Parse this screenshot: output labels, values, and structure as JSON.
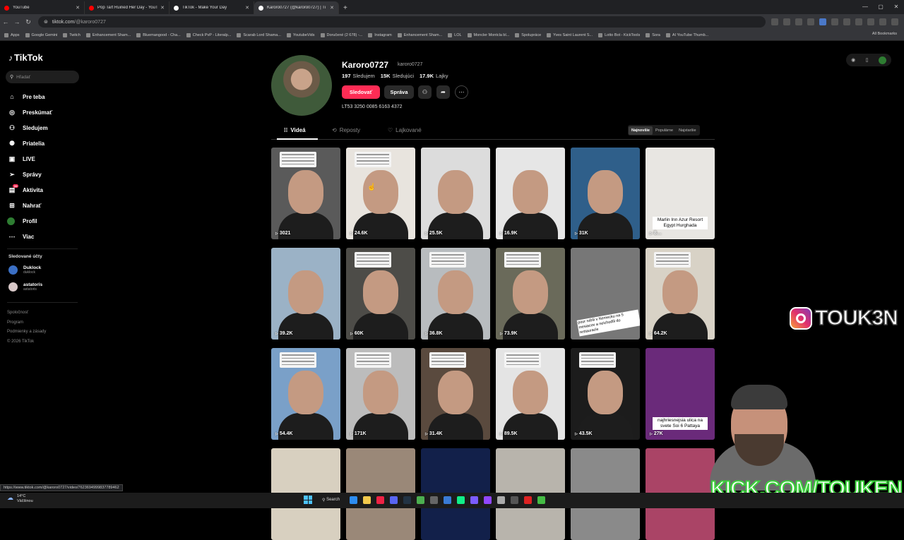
{
  "browser": {
    "tabs": [
      {
        "title": "YouTube",
        "color": "#ff0000"
      },
      {
        "title": "Pop Tart Ruined Her Day - YouT",
        "color": "#ff0000"
      },
      {
        "title": "TikTok - Make Your Day",
        "color": "#ffffff"
      },
      {
        "title": "Karoro0727 (@karoro0727) | Ti",
        "color": "#ffffff"
      }
    ],
    "url_host": "tiktok.com",
    "url_path": "/@karoro0727",
    "bookmarks": [
      "Apps",
      "Google Gemini",
      "Twitch",
      "Enhancement Sham...",
      "Bluemangood - Cha...",
      "Check PvP - Literalp...",
      "Scarab Lord Shama...",
      "YoutubeVids",
      "Doručené (2 678) -...",
      "Instagram",
      "Enhancement Sham...",
      "LOL",
      "Moncler Montcla bl...",
      "Spolupráce",
      "Yves Saint Laurent S...",
      "Lotto Bot - KickTools",
      "Sora",
      "AI YouTube Thumb..."
    ],
    "all_bookmarks": "All Bookmarks"
  },
  "sidebar": {
    "logo": "TikTok",
    "search_placeholder": "Hľadať",
    "items": [
      {
        "label": "Pre teba",
        "icon": "home-icon",
        "glyph": "⌂"
      },
      {
        "label": "Preskúmať",
        "icon": "compass-icon",
        "glyph": "◎"
      },
      {
        "label": "Sledujem",
        "icon": "following-icon",
        "glyph": "⚇"
      },
      {
        "label": "Priatelia",
        "icon": "friends-icon",
        "glyph": "⚉"
      },
      {
        "label": "LIVE",
        "icon": "live-icon",
        "glyph": "▣"
      },
      {
        "label": "Správy",
        "icon": "messages-icon",
        "glyph": "➢"
      },
      {
        "label": "Aktivita",
        "icon": "activity-icon",
        "glyph": "▤",
        "badge": "34"
      },
      {
        "label": "Nahrať",
        "icon": "upload-icon",
        "glyph": "⊞"
      },
      {
        "label": "Profil",
        "icon": "profile-icon",
        "glyph": "●"
      },
      {
        "label": "Viac",
        "icon": "more-icon",
        "glyph": "⋯"
      }
    ],
    "followed_title": "Sledované účty",
    "followed": [
      {
        "name": "Duklock",
        "handle": "duklock"
      },
      {
        "name": "astatoris",
        "handle": "astatoris"
      }
    ],
    "footer": [
      "Spoločnosť",
      "Program",
      "Podmienky a zásady",
      "© 2026 TikTok"
    ]
  },
  "profile": {
    "name": "Karoro0727",
    "username": "karoro0727",
    "following_count": "197",
    "following_label": "Sledujem",
    "followers_count": "15K",
    "followers_label": "Sledujúci",
    "likes_count": "17.9K",
    "likes_label": "Lajky",
    "follow_button": "Sledovať",
    "message_button": "Správa",
    "bio": "LT53 3250 0085 6163 4372"
  },
  "tabs": [
    {
      "label": "Videá",
      "active": true
    },
    {
      "label": "Reposty",
      "active": false
    },
    {
      "label": "Lajkované",
      "active": false
    }
  ],
  "sort": [
    "Najnovšie",
    "Populárne",
    "Najstaršie"
  ],
  "videos": [
    {
      "views": "3021",
      "card": true,
      "bg": "#5a5a5a"
    },
    {
      "views": "24.6K",
      "card": true,
      "bg": "#e8e4de"
    },
    {
      "views": "25.5K",
      "card": false,
      "bg": "#dcdcdc"
    },
    {
      "views": "16.9K",
      "card": false,
      "bg": "#e6e6e6"
    },
    {
      "views": "31K",
      "card": false,
      "bg": "#2f5f8a"
    },
    {
      "views": "8…",
      "card": false,
      "bg": "#e8e6e2",
      "caption": "Marlin Inn Azur Resort Egypt Hurghada"
    },
    {
      "views": "39.2K",
      "card": false,
      "bg": "#9bb2c6"
    },
    {
      "views": "60K",
      "card": true,
      "bg": "#4d4c48"
    },
    {
      "views": "36.8K",
      "card": true,
      "bg": "#b8bcbf"
    },
    {
      "views": "73.9K",
      "card": true,
      "bg": "#6a6a5a"
    },
    {
      "views": "",
      "card": false,
      "bg": "#777",
      "caption2": "pour robili v Nemecku na 5 mesiacov a neichodili do restauracie"
    },
    {
      "views": "64.2K",
      "card": true,
      "bg": "#d8d2c6"
    },
    {
      "views": "54.4K",
      "card": true,
      "bg": "#7aa0c8"
    },
    {
      "views": "171K",
      "card": true,
      "bg": "#bcbcbc"
    },
    {
      "views": "31.4K",
      "card": true,
      "bg": "#5a4a3e"
    },
    {
      "views": "89.5K",
      "card": true,
      "bg": "#e4e4e4"
    },
    {
      "views": "43.5K",
      "card": true,
      "bg": "#1c1c1c"
    },
    {
      "views": "27K",
      "card": false,
      "bg": "#6a2a7a",
      "caption": "najhriesnejsia ulica na svete Soi 6 Pattaya"
    },
    {
      "views": "",
      "card": false,
      "bg": "#d8d0c0"
    },
    {
      "views": "",
      "card": false,
      "bg": "#9a8878"
    },
    {
      "views": "",
      "card": false,
      "bg": "#12204a"
    },
    {
      "views": "",
      "card": false,
      "bg": "#b8b4ac"
    },
    {
      "views": "",
      "card": false,
      "bg": "#8a8a8a"
    },
    {
      "views": "",
      "card": false,
      "bg": "#aa4466"
    }
  ],
  "overlay": {
    "instagram_handle": "TOUK3N",
    "kick_text": "KICK.COM/TOUKEN"
  },
  "status_url": "https://www.tiktok.com/@karoro0727/video/7623694999837789462",
  "taskbar": {
    "temp": "14°C",
    "weather": "Väčšinou",
    "search": "Search"
  }
}
